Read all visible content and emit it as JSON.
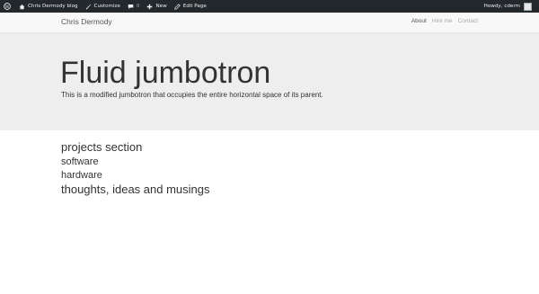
{
  "adminbar": {
    "site_name": "Chris Dermody blog",
    "customize_label": "Customize",
    "comments_count": "0",
    "new_label": "New",
    "edit_page_label": "Edit Page",
    "greeting": "Howdy, cderm"
  },
  "navbar": {
    "brand": "Chris Dermody",
    "links": [
      "About",
      "Hire me",
      "Contact"
    ]
  },
  "jumbotron": {
    "title": "Fluid jumbotron",
    "lead": "This is a modified jumbotron that occupies the entire horizontal space of its parent."
  },
  "sections": {
    "projects": "projects section",
    "software": "software",
    "hardware": "hardware",
    "thoughts": "thoughts, ideas and musings"
  }
}
